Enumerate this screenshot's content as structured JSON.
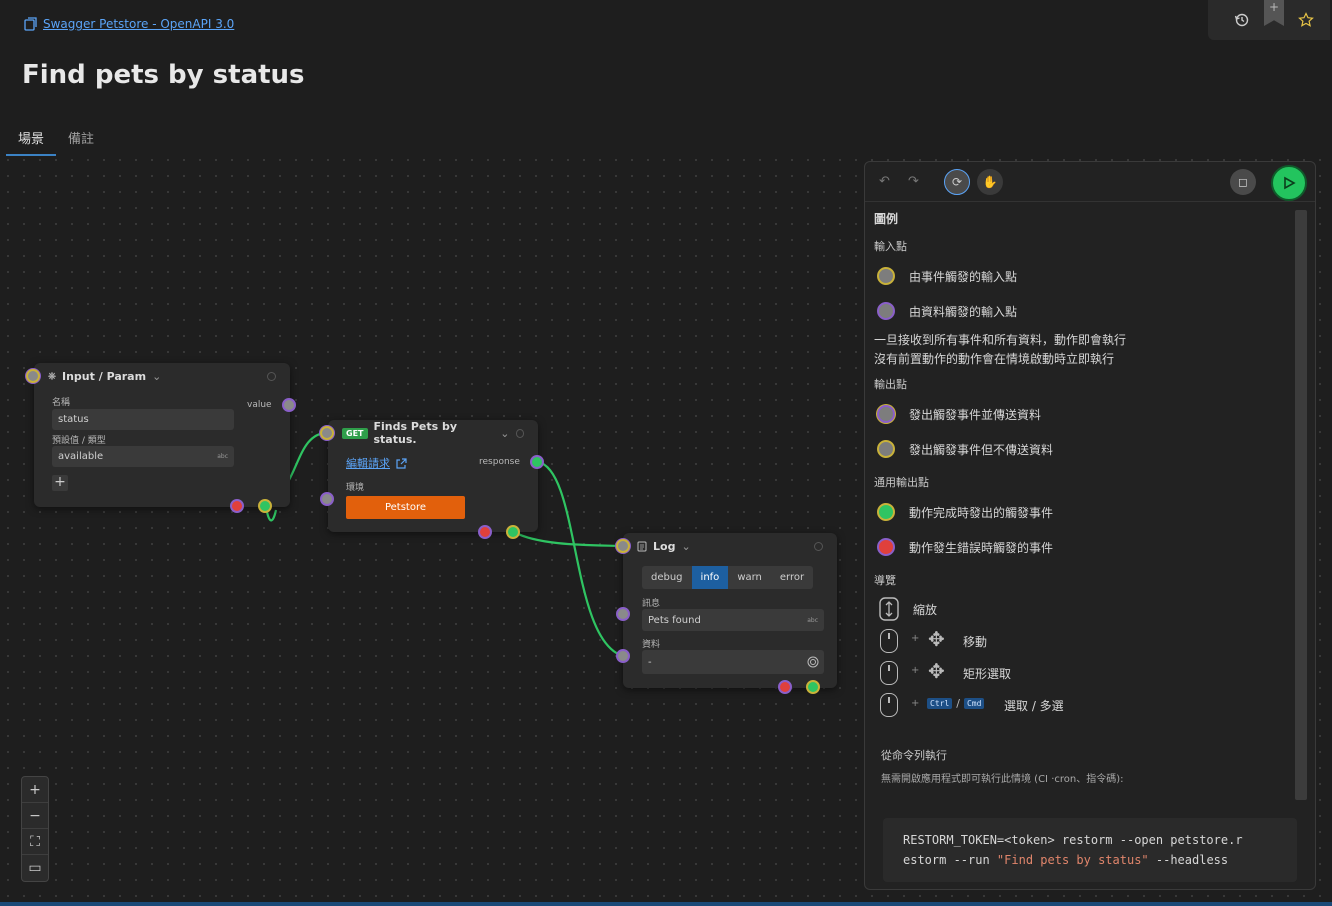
{
  "breadcrumb": {
    "link": "Swagger Petstore - OpenAPI 3.0"
  },
  "page": {
    "title": "Find pets by status"
  },
  "tabs": [
    {
      "label": "場景"
    },
    {
      "label": "備註"
    }
  ],
  "nodes": {
    "input": {
      "title": "Input / Param",
      "name_label": "名稱",
      "name_value": "status",
      "default_label": "預設值 / 類型",
      "default_value": "available",
      "type_badge": "abc",
      "output_label": "value",
      "add_label": "+"
    },
    "request": {
      "method": "GET",
      "title": "Finds Pets by status.",
      "edit_link": "編輯請求",
      "response_label": "response",
      "env_label": "環境",
      "env_value": "Petstore"
    },
    "log": {
      "title": "Log",
      "levels": [
        "debug",
        "info",
        "warn",
        "error"
      ],
      "active_level": "info",
      "message_label": "訊息",
      "message_value": "Pets found",
      "type_badge": "abc",
      "data_label": "資料",
      "data_value": "-"
    }
  },
  "legend": {
    "title": "圖例",
    "inputs_head": "輸入點",
    "event_input": "由事件觸發的輸入點",
    "data_input": "由資料觸發的輸入點",
    "note_line1": "一旦接收到所有事件和所有資料，動作即會執行",
    "note_line2": "沒有前置動作的動作會在情境啟動時立即執行",
    "outputs_head": "輸出點",
    "event_data_output": "發出觸發事件並傳送資料",
    "event_output": "發出觸發事件但不傳送資料",
    "common_head": "通用輸出點",
    "done_output": "動作完成時發出的觸發事件",
    "error_output": "動作發生錯誤時觸發的事件",
    "nav_head": "導覽",
    "zoom": "縮放",
    "move": "移動",
    "rect_select": "矩形選取",
    "ctrl": "Ctrl",
    "cmd": "Cmd",
    "multi_select": "選取 / 多選",
    "plus": "+",
    "slash": "/"
  },
  "cli": {
    "head": "從命令列執行",
    "desc": "無需開啟應用程式即可執行此情境 (CI ·cron、指令碼):",
    "cmd_line1": "RESTORM_TOKEN=<token> restorm --open petstore.r",
    "cmd_line2_pre": "estorm --run ",
    "cmd_line2_str": "\"Find pets by status\"",
    "cmd_line2_post": " --headless"
  },
  "colors": {
    "accent": "#3b82c4",
    "success": "#2fc462",
    "error": "#e0403c",
    "event_port": "#c9b23a",
    "data_port": "#8a5fc9",
    "env_button": "#e2600c"
  }
}
